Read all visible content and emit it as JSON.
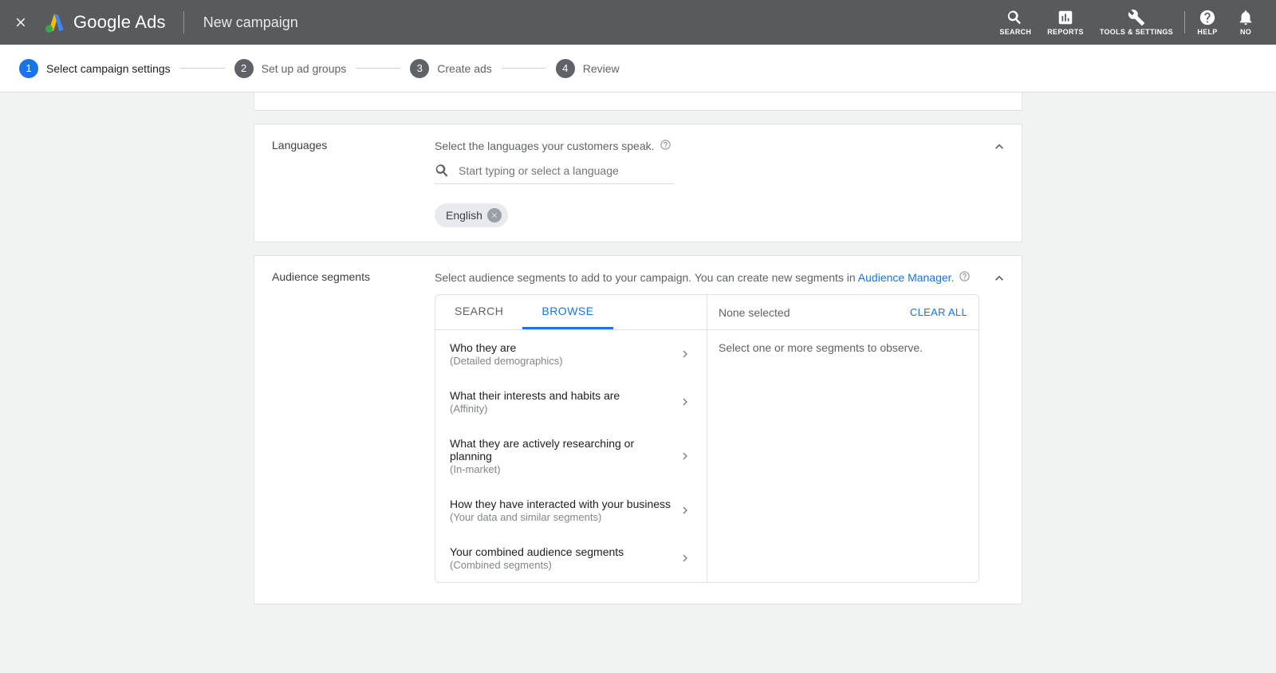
{
  "header": {
    "product": "Google Ads",
    "title": "New campaign",
    "actions": {
      "search": "SEARCH",
      "reports": "REPORTS",
      "tools": "TOOLS & SETTINGS",
      "help": "HELP",
      "notifications": "NO"
    }
  },
  "stepper": {
    "steps": [
      {
        "num": "1",
        "label": "Select campaign settings"
      },
      {
        "num": "2",
        "label": "Set up ad groups"
      },
      {
        "num": "3",
        "label": "Create ads"
      },
      {
        "num": "4",
        "label": "Review"
      }
    ]
  },
  "languages": {
    "label": "Languages",
    "desc": "Select the languages your customers speak.",
    "placeholder": "Start typing or select a language",
    "chips": [
      {
        "label": "English"
      }
    ]
  },
  "audience": {
    "label": "Audience segments",
    "desc_prefix": "Select audience segments to add to your campaign. You can create new segments in ",
    "desc_link": "Audience Manager",
    "desc_suffix": ".",
    "tabs": {
      "search": "Search",
      "browse": "Browse"
    },
    "right": {
      "none": "None selected",
      "clear": "CLEAR ALL",
      "body": "Select one or more segments to observe."
    },
    "items": [
      {
        "t1": "Who they are",
        "t2": "(Detailed demographics)"
      },
      {
        "t1": "What their interests and habits are",
        "t2": "(Affinity)"
      },
      {
        "t1": "What they are actively researching or planning",
        "t2": "(In-market)"
      },
      {
        "t1": "How they have interacted with your business",
        "t2": "(Your data and similar segments)"
      },
      {
        "t1": "Your combined audience segments",
        "t2": "(Combined segments)"
      }
    ]
  }
}
